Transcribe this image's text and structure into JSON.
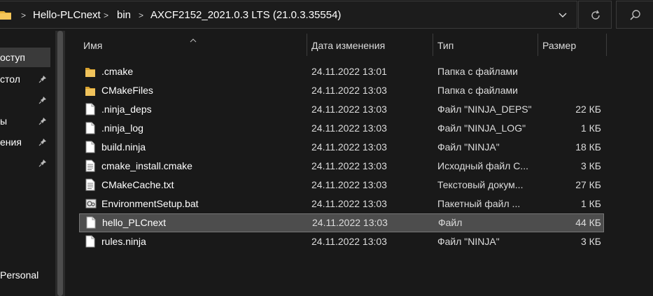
{
  "address_bar": {
    "crumbs": [
      "Hello-PLCnext",
      "bin",
      "AXCF2152_2021.0.3 LTS (21.0.3.35554)"
    ],
    "separator": ">"
  },
  "nav_pane": {
    "items": [
      {
        "label": "оступ",
        "pinned": false,
        "selected": true
      },
      {
        "label": "стол",
        "pinned": true,
        "selected": false
      },
      {
        "label": "",
        "pinned": true,
        "selected": false
      },
      {
        "label": "ы",
        "pinned": true,
        "selected": false
      },
      {
        "label": "ения",
        "pinned": true,
        "selected": false
      },
      {
        "label": "",
        "pinned": true,
        "selected": false
      },
      {
        "label": "Personal",
        "pinned": false,
        "selected": false
      }
    ]
  },
  "columns": {
    "name": "Имя",
    "date": "Дата изменения",
    "type": "Тип",
    "size": "Размер"
  },
  "files": [
    {
      "name": ".cmake",
      "date": "24.11.2022 13:01",
      "type": "Папка с файлами",
      "size": "",
      "icon": "folder-icon",
      "selected": false
    },
    {
      "name": "CMakeFiles",
      "date": "24.11.2022 13:03",
      "type": "Папка с файлами",
      "size": "",
      "icon": "folder-icon",
      "selected": false
    },
    {
      "name": ".ninja_deps",
      "date": "24.11.2022 13:03",
      "type": "Файл \"NINJA_DEPS\"",
      "size": "22 КБ",
      "icon": "file-icon",
      "selected": false
    },
    {
      "name": ".ninja_log",
      "date": "24.11.2022 13:03",
      "type": "Файл \"NINJA_LOG\"",
      "size": "1 КБ",
      "icon": "file-icon",
      "selected": false
    },
    {
      "name": "build.ninja",
      "date": "24.11.2022 13:03",
      "type": "Файл \"NINJA\"",
      "size": "18 КБ",
      "icon": "file-icon",
      "selected": false
    },
    {
      "name": "cmake_install.cmake",
      "date": "24.11.2022 13:03",
      "type": "Исходный файл C...",
      "size": "3 КБ",
      "icon": "text-file-icon",
      "selected": false
    },
    {
      "name": "CMakeCache.txt",
      "date": "24.11.2022 13:03",
      "type": "Текстовый докум...",
      "size": "27 КБ",
      "icon": "text-file-icon",
      "selected": false
    },
    {
      "name": "EnvironmentSetup.bat",
      "date": "24.11.2022 13:03",
      "type": "Пакетный файл ...",
      "size": "1 КБ",
      "icon": "batch-file-icon",
      "selected": false
    },
    {
      "name": "hello_PLCnext",
      "date": "24.11.2022 13:03",
      "type": "Файл",
      "size": "44 КБ",
      "icon": "file-icon",
      "selected": true
    },
    {
      "name": "rules.ninja",
      "date": "24.11.2022 13:03",
      "type": "Файл \"NINJA\"",
      "size": "3 КБ",
      "icon": "file-icon",
      "selected": false
    }
  ],
  "colors": {
    "background": "#191919",
    "selection": "#4d4d4d",
    "folder": "#e8b33b"
  }
}
